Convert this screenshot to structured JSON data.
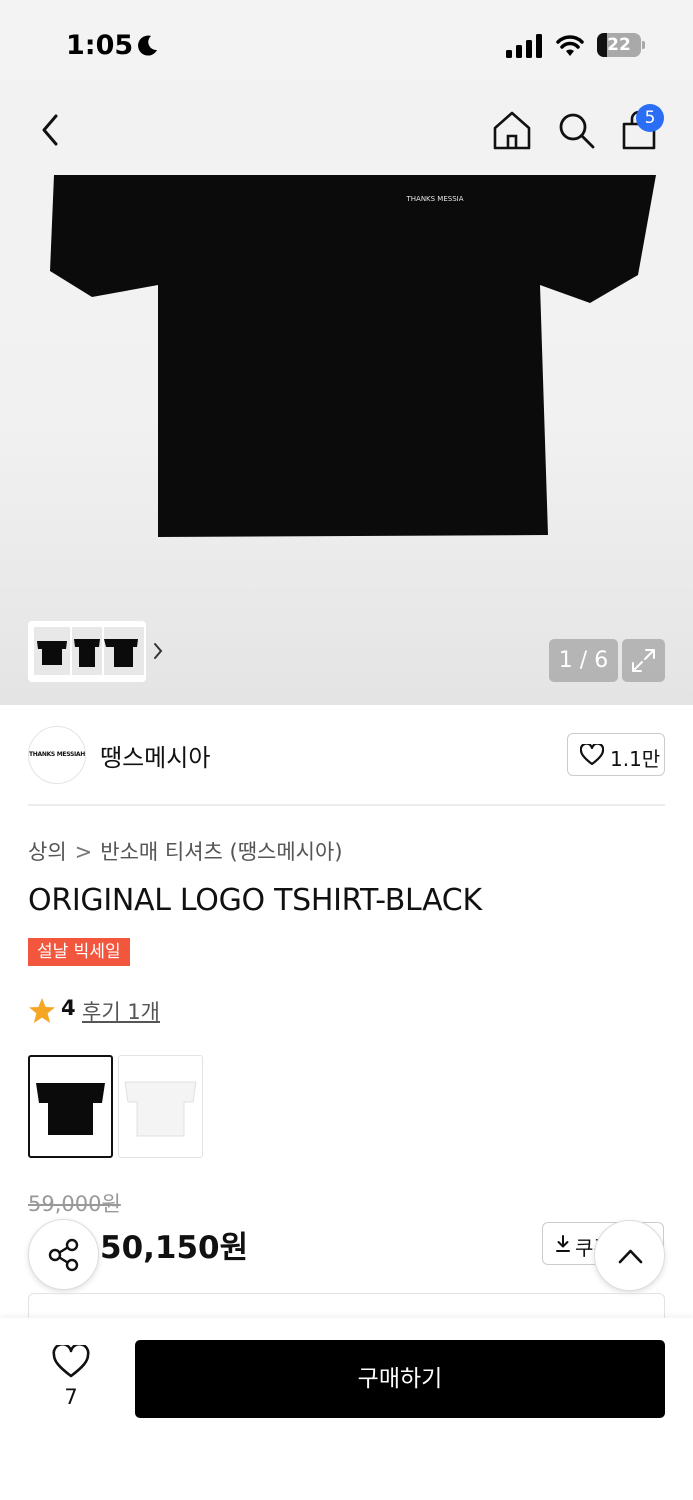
{
  "status_bar": {
    "time": "1:05",
    "battery": "22"
  },
  "nav": {
    "cart_count": "5"
  },
  "gallery": {
    "page_indicator": "1 / 6",
    "image_caption": "THANKS MESSIA"
  },
  "brand": {
    "logo_text": "THANKS MESSIAH",
    "name": "땡스메시아",
    "likes": "1.1만"
  },
  "product": {
    "breadcrumb": [
      "상의",
      "반소매 티셔츠 (땡스메시아)"
    ],
    "title": "ORIGINAL LOGO TSHIRT-BLACK",
    "sale_badge": "설날 빅세일",
    "rating": "4",
    "review_link": "후기 1개",
    "colors": [
      "black",
      "white"
    ],
    "original_price": "59,000원",
    "sale_price": "50,150원",
    "coupon_label": "쿠폰"
  },
  "bottom_bar": {
    "wish_count": "7",
    "buy_label": "구매하기"
  },
  "colors": {
    "accent_blue": "#2a6ef5",
    "sale_red": "#f2573e",
    "star": "#f5a623"
  }
}
